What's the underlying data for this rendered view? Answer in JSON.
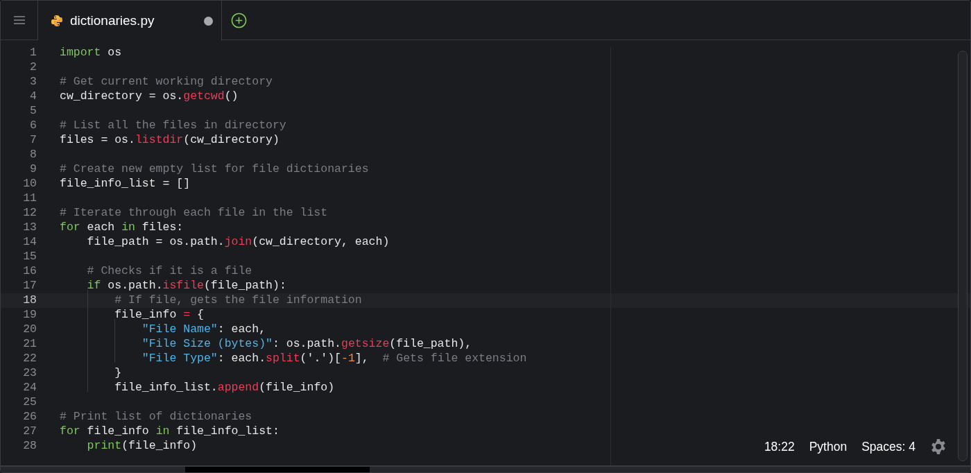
{
  "tabs": [
    {
      "label": "dictionaries.py",
      "selected": true,
      "modified": true
    }
  ],
  "code_lines": [
    {
      "number": "1",
      "active": false,
      "tokens": [
        {
          "kind": "keyword",
          "text": "import"
        },
        {
          "kind": "plain",
          "text": " os"
        }
      ]
    },
    {
      "number": "2",
      "active": false
    },
    {
      "number": "3",
      "active": false,
      "tokens": [
        {
          "kind": "comment",
          "text": "# Get current working directory"
        }
      ]
    },
    {
      "number": "4",
      "active": false,
      "tokens": [
        {
          "kind": "plain",
          "text": "cw_directory = os."
        },
        {
          "kind": "function",
          "text": "getcwd"
        },
        {
          "kind": "plain",
          "text": "()"
        }
      ]
    },
    {
      "number": "5",
      "active": false
    },
    {
      "number": "6",
      "active": false,
      "tokens": [
        {
          "kind": "comment",
          "text": "# List all the files in directory"
        }
      ]
    },
    {
      "number": "7",
      "active": false,
      "tokens": [
        {
          "kind": "plain",
          "text": "files = os."
        },
        {
          "kind": "function",
          "text": "listdir"
        },
        {
          "kind": "plain",
          "text": "(cw_directory)"
        }
      ]
    },
    {
      "number": "8",
      "active": false
    },
    {
      "number": "9",
      "active": false,
      "tokens": [
        {
          "kind": "comment",
          "text": "# Create new empty list for file dictionaries"
        }
      ]
    },
    {
      "number": "10",
      "active": false,
      "tokens": [
        {
          "kind": "plain",
          "text": "file_info_list = []"
        }
      ]
    },
    {
      "number": "11",
      "active": false
    },
    {
      "number": "12",
      "active": false,
      "tokens": [
        {
          "kind": "comment",
          "text": "# Iterate through each file in the list"
        }
      ]
    },
    {
      "number": "13",
      "active": false,
      "tokens": [
        {
          "kind": "keyword",
          "text": "for"
        },
        {
          "kind": "plain",
          "text": " each "
        },
        {
          "kind": "keyword",
          "text": "in"
        },
        {
          "kind": "plain",
          "text": " files:"
        }
      ]
    },
    {
      "number": "14",
      "active": false,
      "tokens": [
        {
          "kind": "plain",
          "text": "    file_path = os.path."
        },
        {
          "kind": "function",
          "text": "join"
        },
        {
          "kind": "plain",
          "text": "(cw_directory, each)"
        }
      ]
    },
    {
      "number": "15",
      "active": false
    },
    {
      "number": "16",
      "active": false,
      "tokens": [
        {
          "kind": "comment",
          "text": "    # Checks if it is a file"
        }
      ]
    },
    {
      "number": "17",
      "active": false,
      "tokens": [
        {
          "kind": "keyword",
          "text": "    if"
        },
        {
          "kind": "plain",
          "text": " os.path."
        },
        {
          "kind": "function",
          "text": "isfile"
        },
        {
          "kind": "plain",
          "text": "(file_path):"
        }
      ]
    },
    {
      "number": "18",
      "active": true,
      "tokens": [
        {
          "kind": "comment",
          "text": "        # If file, gets the file information"
        }
      ]
    },
    {
      "number": "19",
      "active": false,
      "tokens": [
        {
          "kind": "plain",
          "text": "        file_info "
        },
        {
          "kind": "operator",
          "text": "="
        },
        {
          "kind": "plain",
          "text": " {"
        }
      ]
    },
    {
      "number": "20",
      "active": false,
      "tokens": [
        {
          "kind": "string",
          "text": "            \"File Name\""
        },
        {
          "kind": "plain",
          "text": ": each,"
        }
      ]
    },
    {
      "number": "21",
      "active": false,
      "tokens": [
        {
          "kind": "string",
          "text": "            \"File Size (bytes)\""
        },
        {
          "kind": "plain",
          "text": ": os.path."
        },
        {
          "kind": "function",
          "text": "getsize"
        },
        {
          "kind": "plain",
          "text": "(file_path),"
        }
      ]
    },
    {
      "number": "22",
      "active": false,
      "tokens": [
        {
          "kind": "string",
          "text": "            \"File Type\""
        },
        {
          "kind": "plain",
          "text": ": each."
        },
        {
          "kind": "function",
          "text": "split"
        },
        {
          "kind": "plain",
          "text": "('.')["
        },
        {
          "kind": "number",
          "text": "-1"
        },
        {
          "kind": "plain",
          "text": "],  "
        },
        {
          "kind": "comment",
          "text": "# Gets file extension"
        }
      ]
    },
    {
      "number": "23",
      "active": false,
      "tokens": [
        {
          "kind": "plain",
          "text": "        }"
        }
      ]
    },
    {
      "number": "24",
      "active": false,
      "tokens": [
        {
          "kind": "plain",
          "text": "        file_info_list."
        },
        {
          "kind": "function",
          "text": "append"
        },
        {
          "kind": "plain",
          "text": "(file_info)"
        }
      ]
    },
    {
      "number": "25",
      "active": false
    },
    {
      "number": "26",
      "active": false,
      "tokens": [
        {
          "kind": "comment",
          "text": "# Print list of dictionaries"
        }
      ]
    },
    {
      "number": "27",
      "active": false,
      "tokens": [
        {
          "kind": "keyword",
          "text": "for"
        },
        {
          "kind": "plain",
          "text": " file_info "
        },
        {
          "kind": "keyword",
          "text": "in"
        },
        {
          "kind": "plain",
          "text": " file_info_list:"
        }
      ]
    },
    {
      "number": "28",
      "active": false,
      "tokens": [
        {
          "kind": "keyword",
          "text": "    print"
        },
        {
          "kind": "plain",
          "text": "(file_info)"
        }
      ]
    }
  ],
  "status_bar": {
    "cursor_position": "18:22",
    "language": "Python",
    "indentation": "Spaces: 4"
  }
}
